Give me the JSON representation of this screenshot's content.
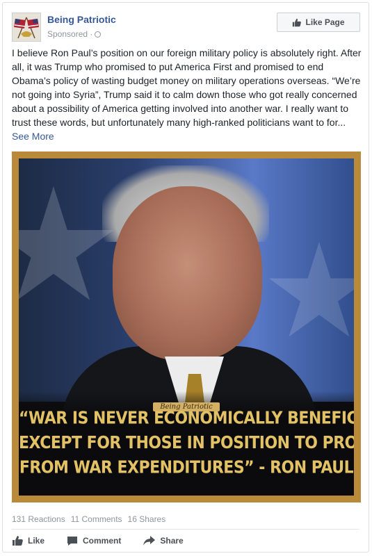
{
  "post": {
    "page_name": "Being Patriotic",
    "sponsored": "Sponsored ·",
    "like_page_label": "Like Page",
    "text": "I believe Ron Paul’s position on our foreign military policy is absolutely right. After all, it was Trump who promised to put America First and promised to end Obama’s policy of wasting budget money on military operations overseas. “We’re not going into Syria”, Trump said it to calm down those who got really concerned about a possibility of America getting involved into another war. I really want to trust these words, but unfortunately many high-ranked politicians want to for...",
    "see_more": "See More",
    "image": {
      "watermark": "Being Patriotic",
      "quote_lines": [
        "“War is never economically beneficial",
        "except for those in position to profit",
        "from war expenditures” - Ron Paul"
      ]
    },
    "stats": {
      "reactions": "131 Reactions",
      "comments": "11 Comments",
      "shares": "16 Shares"
    },
    "actions": {
      "like": "Like",
      "comment": "Comment",
      "share": "Share"
    }
  },
  "icons": {
    "globe": "globe-icon",
    "thumbs_up": "thumbs-up-icon",
    "comment": "comment-icon",
    "share": "share-icon"
  },
  "colors": {
    "link": "#365899",
    "meta": "#90949c",
    "quote_gold": "#e3c265",
    "frame_gold": "#b88a3a"
  }
}
